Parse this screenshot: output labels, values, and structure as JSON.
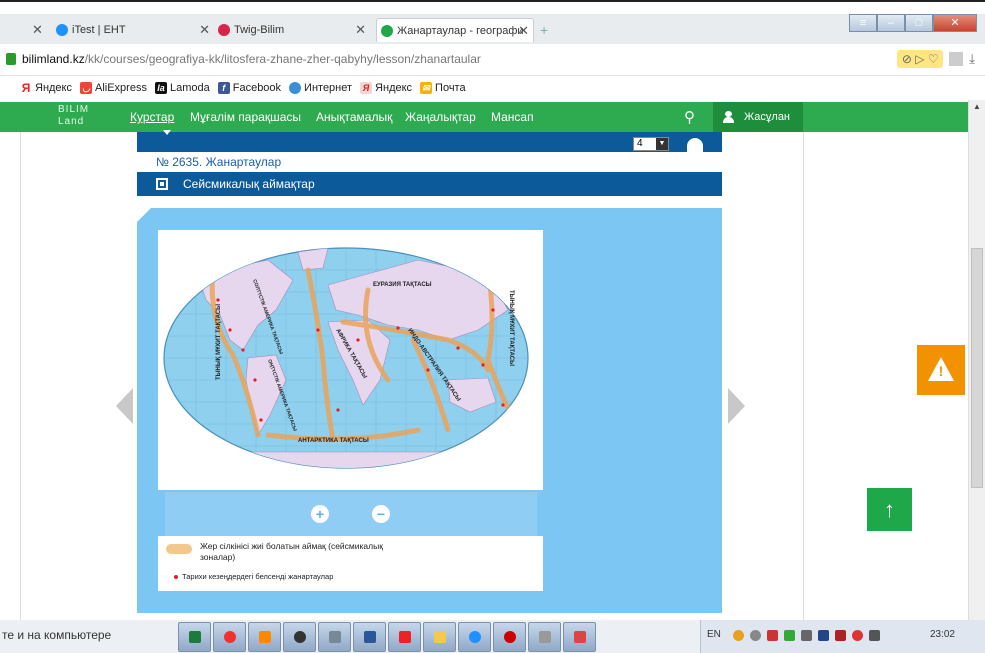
{
  "browser": {
    "tabs": [
      {
        "label": "",
        "active": false
      },
      {
        "label": "iTest | ЕНТ",
        "active": false
      },
      {
        "label": "Twig-Bilim",
        "active": false
      },
      {
        "label": "Жанартаулар - географи",
        "active": true
      }
    ],
    "address": {
      "domain": "bilimland.kz",
      "path": "/kk/courses/geografiya-kk/litosfera-zhane-zher-qabyhy/lesson/zhanartaular"
    },
    "bookmarks": [
      "Яндекс",
      "AliExpress",
      "Lamoda",
      "Facebook",
      "Интернет",
      "Яндекс",
      "Почта"
    ]
  },
  "site": {
    "logo_top": "BILIM",
    "logo_bottom": "Land",
    "nav": [
      "Курстар",
      "Мұғалім парақшасы",
      "Анықтамалық",
      "Жаңалықтар",
      "Мансап"
    ],
    "user_name": "Жасұлан",
    "page_select_value": "4",
    "lesson_number": "№ 2635. Жанартаулар",
    "section_title": "Сейсмикалық аймақтар",
    "map": {
      "plates": [
        "ЕУРАЗИЯ ТАҚТАСЫ",
        "АФРИКА ТАҚТАСЫ",
        "ИНДО-АВСТРАЛИЯ ТАҚТАСЫ",
        "АНТАРКТИКА ТАҚТАСЫ",
        "ТЫНЫҚ МҰХИТ ТАҚТАСЫ",
        "ТЫНЫҚ МҰХИТ ТАҚТАСЫ",
        "СОЛТҮСТІК АМЕРИКА ТАҚТАСЫ",
        "ОҢТҮСТІК АМЕРИКА ТАҚТАСЫ"
      ]
    },
    "legend": {
      "zone_label": "Жер сілкінісі жиі болатын аймақ (сейсмикалық зоналар)",
      "volcano_label": "Тарихи кезеңдердегі белсенді жанартаулар"
    }
  },
  "taskbar": {
    "left_text": "те и на компьютере",
    "lang": "EN",
    "time": "23:02"
  },
  "colors": {
    "nav_green": "#2eab50",
    "dark_blue": "#0c5a9a",
    "light_blue": "#7cc6f3",
    "warning_orange": "#f39200",
    "seismic_zone": "#f2c98a"
  }
}
